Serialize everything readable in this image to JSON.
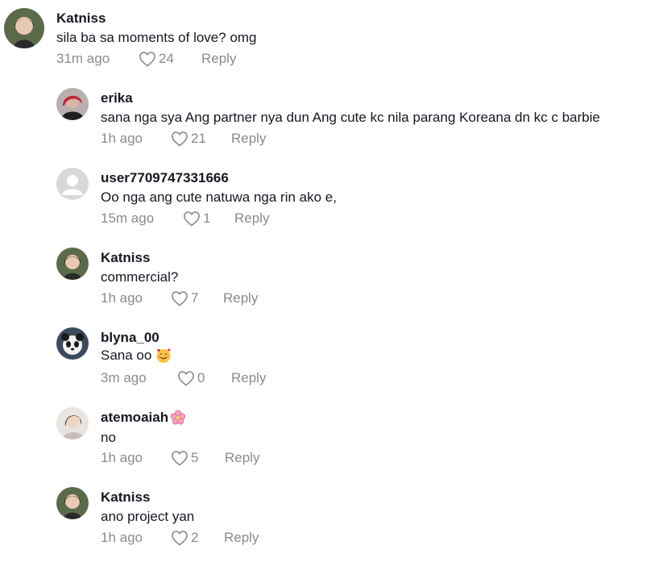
{
  "comments": [
    {
      "username": "Katniss",
      "text": "sila ba sa moments of love? omg",
      "time": "31m ago",
      "likes": "24",
      "reply": "Reply"
    },
    {
      "username": "erika",
      "text": "sana nga sya Ang partner nya dun Ang cute kc nila parang Koreana dn kc c barbie",
      "time": "1h ago",
      "likes": "21",
      "reply": "Reply"
    },
    {
      "username": "user7709747331666",
      "text": "Oo nga ang cute natuwa nga rin ako e,",
      "time": "15m ago",
      "likes": "1",
      "reply": "Reply"
    },
    {
      "username": "Katniss",
      "text": "commercial?",
      "time": "1h ago",
      "likes": "7",
      "reply": "Reply"
    },
    {
      "username": "blyna_00",
      "text": "Sana oo",
      "time": "3m ago",
      "likes": "0",
      "reply": "Reply"
    },
    {
      "username": "atemoaiah",
      "text": "no",
      "time": "1h ago",
      "likes": "5",
      "reply": "Reply"
    },
    {
      "username": "Katniss",
      "text": "ano project yan",
      "time": "1h ago",
      "likes": "2",
      "reply": "Reply"
    }
  ],
  "icons": {
    "like": "heart-outline-icon",
    "emoji_smiling_hearts": "smiling-face-with-hearts-emoji",
    "emoji_cherry_blossom": "cherry-blossom-emoji"
  },
  "colors": {
    "text_primary": "#161823",
    "text_secondary": "#8a8b91",
    "background": "#ffffff"
  }
}
